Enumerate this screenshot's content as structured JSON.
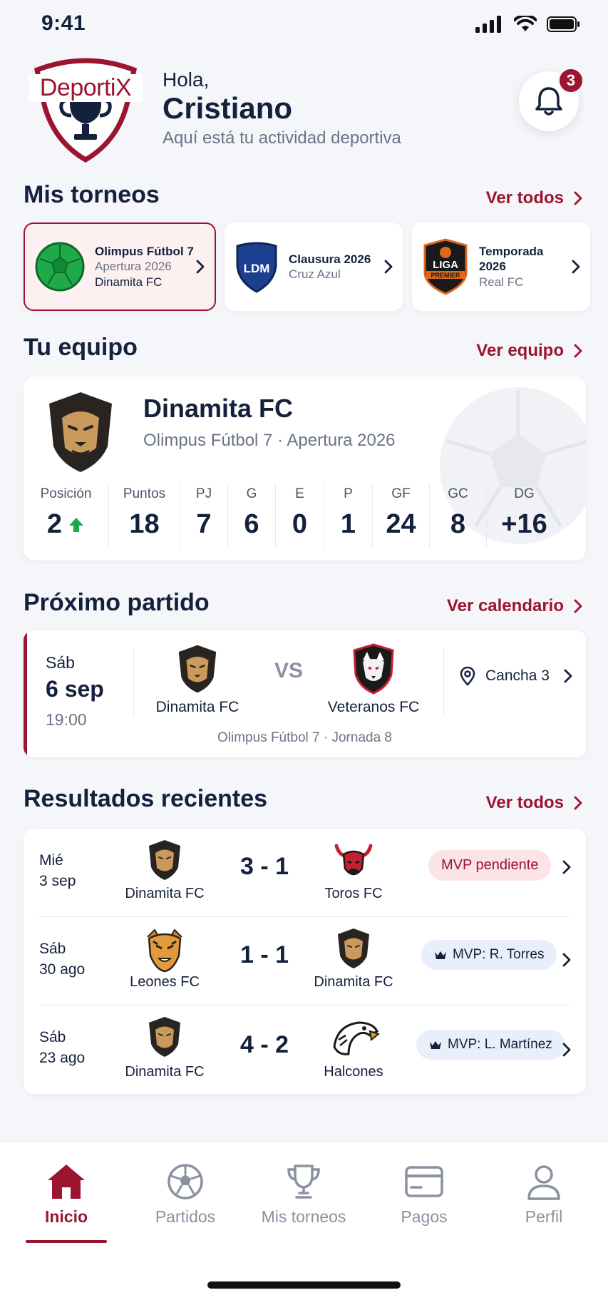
{
  "status_bar": {
    "time": "9:41"
  },
  "header": {
    "brand": "DeportiX",
    "greeting": "Hola,",
    "user_name": "Cristiano",
    "subtitle": "Aquí está tu actividad deportiva",
    "notifications_count": "3"
  },
  "tournaments": {
    "title": "Mis torneos",
    "link": "Ver todos",
    "items": [
      {
        "name": "Olimpus Fútbol 7",
        "season": "Apertura 2026",
        "team": "Dinamita FC",
        "active": true
      },
      {
        "name": "Clausura 2026",
        "season": "Cruz Azul",
        "logo_text": "LDM"
      },
      {
        "name": "Temporada 2026",
        "season": "Real FC",
        "logo_text_top": "LIGA",
        "logo_text_bottom": "PREMIER"
      }
    ]
  },
  "team": {
    "title": "Tu equipo",
    "link": "Ver equipo",
    "name": "Dinamita FC",
    "league": "Olimpus Fútbol 7 · Apertura 2026",
    "stats": [
      {
        "label": "Posición",
        "value": "2",
        "trend": "up"
      },
      {
        "label": "Puntos",
        "value": "18"
      },
      {
        "label": "PJ",
        "value": "7"
      },
      {
        "label": "G",
        "value": "6"
      },
      {
        "label": "E",
        "value": "0"
      },
      {
        "label": "P",
        "value": "1"
      },
      {
        "label": "GF",
        "value": "24"
      },
      {
        "label": "GC",
        "value": "8"
      },
      {
        "label": "DG",
        "value": "+16"
      }
    ]
  },
  "next_match": {
    "title": "Próximo partido",
    "link": "Ver calendario",
    "day": "Sáb",
    "date": "6 sep",
    "time": "19:00",
    "home": "Dinamita FC",
    "vs": "VS",
    "away": "Veteranos FC",
    "venue": "Cancha 3",
    "round": "Olimpus Fútbol 7 · Jornada 8"
  },
  "results": {
    "title": "Resultados recientes",
    "link": "Ver todos",
    "items": [
      {
        "day": "Mié",
        "date": "3 sep",
        "home": "Dinamita FC",
        "score": "3 - 1",
        "away": "Toros FC",
        "mvp": "MVP pendiente",
        "mvp_pending": true
      },
      {
        "day": "Sáb",
        "date": "30 ago",
        "home": "Leones FC",
        "score": "1 - 1",
        "away": "Dinamita FC",
        "mvp": "MVP: R. Torres"
      },
      {
        "day": "Sáb",
        "date": "23 ago",
        "home": "Dinamita FC",
        "score": "4 - 2",
        "away": "Halcones",
        "mvp": "MVP: L. Martínez"
      }
    ]
  },
  "nav": {
    "items": [
      {
        "label": "Inicio",
        "icon": "home-icon",
        "active": true
      },
      {
        "label": "Partidos",
        "icon": "soccer-ball-icon"
      },
      {
        "label": "Mis torneos",
        "icon": "trophy-icon"
      },
      {
        "label": "Pagos",
        "icon": "card-icon"
      },
      {
        "label": "Perfil",
        "icon": "user-icon"
      }
    ]
  },
  "colors": {
    "primary": "#9b1530",
    "navy": "#14213d",
    "background": "#f5f6fa",
    "success": "#1fa84a"
  }
}
